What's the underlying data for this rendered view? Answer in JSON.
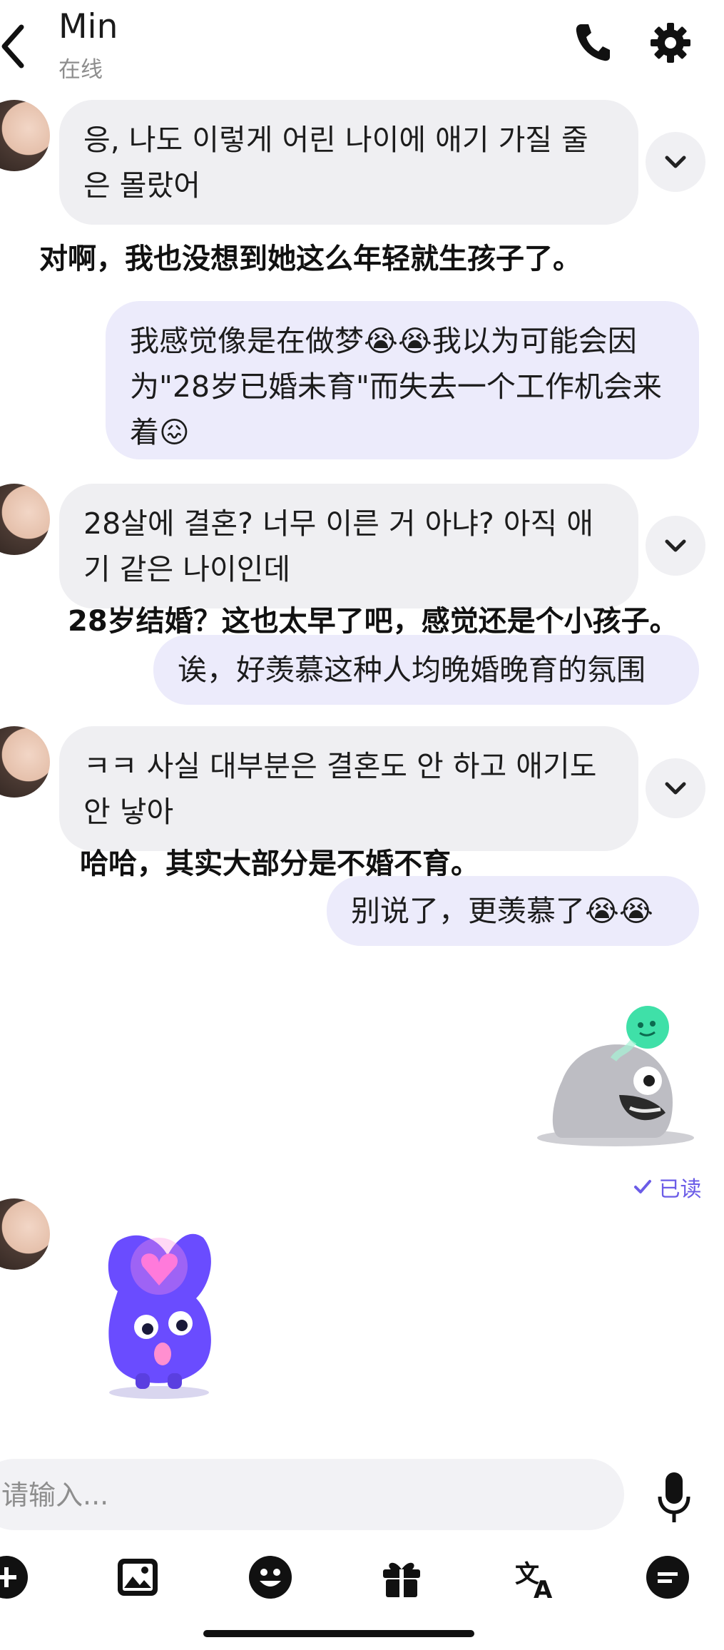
{
  "header": {
    "contact_name": "Min",
    "contact_status": "在线"
  },
  "messages": [
    {
      "side": "received",
      "text": "응, 나도 이렇게 어린 나이에 애기 가질 줄은 몰랐어",
      "caption": "对啊，我也没想到她这么年轻就生孩子了。"
    },
    {
      "side": "sent",
      "text": "我感觉像是在做梦😭😭我以为可能会因为\"28岁已婚未育\"而失去一个工作机会来着😖"
    },
    {
      "side": "received",
      "text": "28살에 결혼? 너무 이른 거 아냐? 아직 애기 같은 나이인데",
      "caption": "28岁结婚？这也太早了吧，感觉还是个小孩子。"
    },
    {
      "side": "sent",
      "text": "诶，好羡慕这种人均晚婚晚育的氛围"
    },
    {
      "side": "received",
      "text": "ㅋㅋ 사실 대부분은 결혼도 안 하고 애기도 안 낳아",
      "caption": "哈哈，其实大部分是不婚不育。"
    },
    {
      "side": "sent",
      "text": "别说了，更羡慕了😭😭"
    }
  ],
  "read_status": "已读",
  "input": {
    "placeholder": "请输入..."
  },
  "toolbar": {
    "items": [
      "plus-icon",
      "image-icon",
      "emoji-icon",
      "gift-icon",
      "translate-icon",
      "more-icon"
    ]
  },
  "colors": {
    "accent": "#6b5ce7",
    "received_bubble": "#efeff2",
    "sent_bubble": "#ecebfb",
    "sticker_purple": "#6a4cff"
  }
}
